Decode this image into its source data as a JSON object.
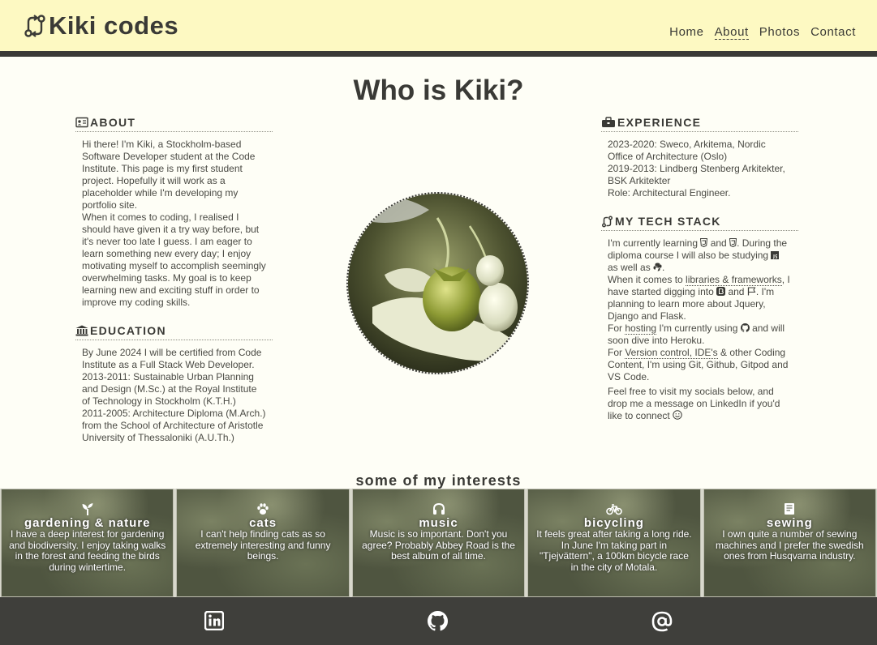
{
  "header": {
    "brand": "Kiki codes",
    "brand_icon": "code-branch-icon",
    "nav": [
      {
        "label": "Home",
        "active": false
      },
      {
        "label": "About",
        "active": true
      },
      {
        "label": "Photos",
        "active": false
      },
      {
        "label": "Contact",
        "active": false
      }
    ]
  },
  "main": {
    "title": "Who is Kiki?",
    "about": {
      "heading": "ABOUT",
      "icon": "id-card-icon",
      "p1": "Hi there! I'm Kiki, a Stockholm-based Software Developer student at the Code Institute. This page is my first student project. Hopefully it will work as a placeholder while I'm developing my portfolio site.",
      "p2": "When it comes to coding, I realised I should have given it a try way before, but it's never too late I guess. I am eager to learn something new every day; I enjoy motivating myself to accomplish seemingly overwhelming tasks. My goal is to keep learning new and exciting stuff in order to improve my coding skills."
    },
    "education": {
      "heading": "EDUCATION",
      "icon": "university-icon",
      "p1": "By June 2024 I will be certified from Code Institute as a Full Stack Web Developer.",
      "p2": "2013-2011: Sustainable Urban Planning and Design (M.Sc.) at the Royal Institute of Technology in Stockholm (K.T.H.)",
      "p3": "2011-2005: Architecture Diploma (M.Arch.) from the School of Architecture of Aristotle University of Thessaloniki (A.U.Th.)"
    },
    "experience": {
      "heading": "EXPERIENCE",
      "icon": "toolbox-icon",
      "p1": "2023-2020: Sweco, Arkitema, Nordic Office of Architecture (Oslo)",
      "p2": "2019-2013: Lindberg Stenberg Arkitekter, BSK Arkitekter",
      "p3": "Role: Architectural Engineer."
    },
    "stack": {
      "heading": "MY TECH STACK",
      "icon": "code-branch-icon",
      "l1a": "I'm currently learning",
      "l1b": "and",
      "l1c": ". During the diploma course I will also be studying",
      "l1d": "as well as",
      "l1e": ".",
      "l2a": "When it comes to",
      "l2b": "libraries & frameworks",
      "l2c": ", I have started digging into",
      "l2d": "and",
      "l2e": ". I'm planning to learn more about Jquery, Django and Flask.",
      "l3a": "For",
      "l3b": "hosting",
      "l3c": "I'm currently using",
      "l3d": "and will soon dive into Heroku.",
      "l4a": "For",
      "l4b": "Version control, IDE's",
      "l4c": "& other Coding Content, I'm using Git, Github, Gitpod and VS Code.",
      "l5": "Feel free to visit my socials below, and drop me a message on LinkedIn if you'd like to connect"
    },
    "portrait_alt": "strawberry-in-hand-photo"
  },
  "interests": {
    "title": "some of my interests",
    "cards": [
      {
        "icon": "seedling-icon",
        "title": "gardening & nature",
        "text": "I have a deep interest for gardening and biodiversity. I enjoy taking walks in the forest and feeding the birds during wintertime."
      },
      {
        "icon": "paw-icon",
        "title": "cats",
        "text": "I can't help finding cats as so extremely interesting and funny beings."
      },
      {
        "icon": "headphones-icon",
        "title": "music",
        "text": "Music is so important. Don't you agree? Probably Abbey Road is the best album of all time."
      },
      {
        "icon": "bicycle-icon",
        "title": "bicycling",
        "text": "It feels great after taking a long ride. In June I'm taking part in \"Tjejvättern\", a 100km bicycle race in the city of Motala."
      },
      {
        "icon": "sewing-icon",
        "title": "sewing",
        "text": "I own quite a number of sewing machines and I prefer the swedish ones from Husqvarna industry."
      }
    ]
  },
  "footer": {
    "links": [
      {
        "icon": "linkedin-icon"
      },
      {
        "icon": "github-icon"
      },
      {
        "icon": "at-icon"
      }
    ]
  },
  "colors": {
    "header_bg": "#fdf9c2",
    "dark": "#3a3a36",
    "page_bg": "#fefef6",
    "footer_bg": "#3f3f3b"
  }
}
